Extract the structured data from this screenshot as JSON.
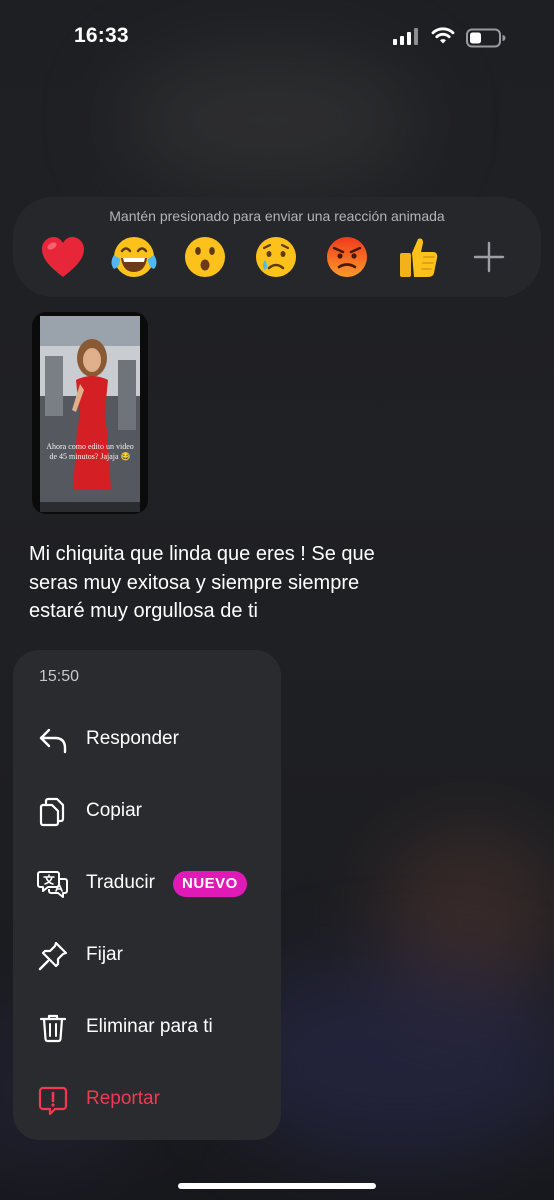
{
  "status_bar": {
    "time": "16:33"
  },
  "reactions": {
    "hint": "Mantén presionado para enviar una reacción animada",
    "emojis": [
      "heart",
      "tears-of-joy",
      "surprised",
      "crying",
      "angry",
      "thumbs-up"
    ],
    "more": "plus-icon"
  },
  "message": {
    "media_caption": "Ahora como edito un video de 45 minutos? Jajaja 😂",
    "text": "Mi chiquita que linda que eres ! Se que seras muy exitosa y siempre siempre estaré muy orgullosa de ti"
  },
  "menu": {
    "time": "15:50",
    "items": [
      {
        "label": "Responder",
        "icon": "reply-icon"
      },
      {
        "label": "Copiar",
        "icon": "copy-icon"
      },
      {
        "label": "Traducir",
        "icon": "translate-icon",
        "badge": "NUEVO"
      },
      {
        "label": "Fijar",
        "icon": "pin-icon"
      },
      {
        "label": "Eliminar para ti",
        "icon": "trash-icon"
      },
      {
        "label": "Reportar",
        "icon": "report-icon"
      }
    ]
  },
  "colors": {
    "badge": "#e01ab6",
    "danger": "#f5384f",
    "menu_bg": "#2a2b2f"
  }
}
